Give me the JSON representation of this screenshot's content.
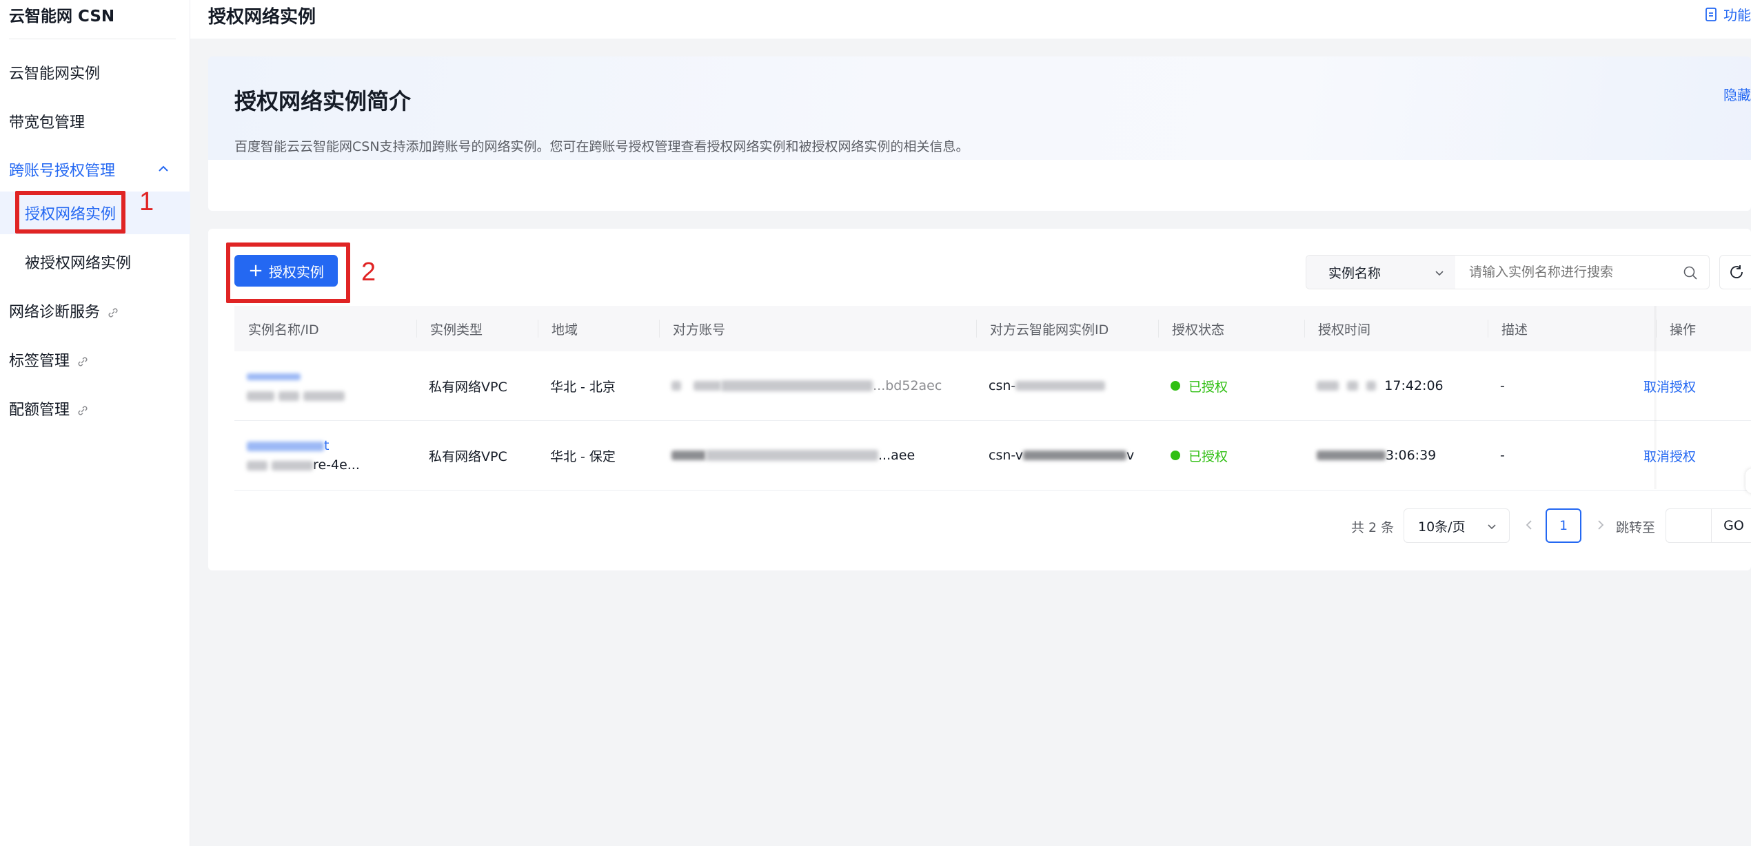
{
  "app": {
    "brand": "云智能网 CSN"
  },
  "sidebar": {
    "items": [
      {
        "label": "云智能网实例"
      },
      {
        "label": "带宽包管理"
      },
      {
        "label": "跨账号授权管理"
      },
      {
        "label": "授权网络实例"
      },
      {
        "label": "被授权网络实例"
      },
      {
        "label": "网络诊断服务"
      },
      {
        "label": "标签管理"
      },
      {
        "label": "配额管理"
      }
    ]
  },
  "header": {
    "title": "授权网络实例",
    "help_label": "功能"
  },
  "intro": {
    "title": "授权网络实例简介",
    "description": "百度智能云云智能网CSN支持添加跨账号的网络实例。您可在跨账号授权管理查看授权网络实例和被授权网络实例的相关信息。",
    "hide_label": "隐藏"
  },
  "annotations": {
    "first": "1",
    "second": "2"
  },
  "toolbar": {
    "add_button_label": "授权实例",
    "search_field": "实例名称",
    "search_placeholder": "请输入实例名称进行搜索"
  },
  "table": {
    "columns": [
      "实例名称/ID",
      "实例类型",
      "地域",
      "对方账号",
      "对方云智能网实例ID",
      "授权状态",
      "授权时间",
      "描述",
      "操作"
    ],
    "rows": [
      {
        "type": "私有网络VPC",
        "region": "华北 - 北京",
        "account_tail": "...bd52aec",
        "csn_prefix": "csn-",
        "status": "已授权",
        "time": "17:42:06",
        "desc": "-",
        "action": "取消授权"
      },
      {
        "type": "私有网络VPC",
        "region": "华北 - 保定",
        "account_tail": "...aee",
        "csn_prefix": "csn-v",
        "csn_suffix": "v",
        "status": "已授权",
        "time": "3:06:39",
        "desc": "-",
        "action": "取消授权"
      }
    ],
    "row2_name_tail": "t",
    "row2_id_tail": "re-4e..."
  },
  "pagination": {
    "total": "共 2 条",
    "page_size": "10条/页",
    "current_page": "1",
    "jump_label": "跳转至",
    "go_label": "GO"
  },
  "colors": {
    "accent": "#2468f2",
    "success": "#30bf13",
    "annotation": "#e02424"
  }
}
